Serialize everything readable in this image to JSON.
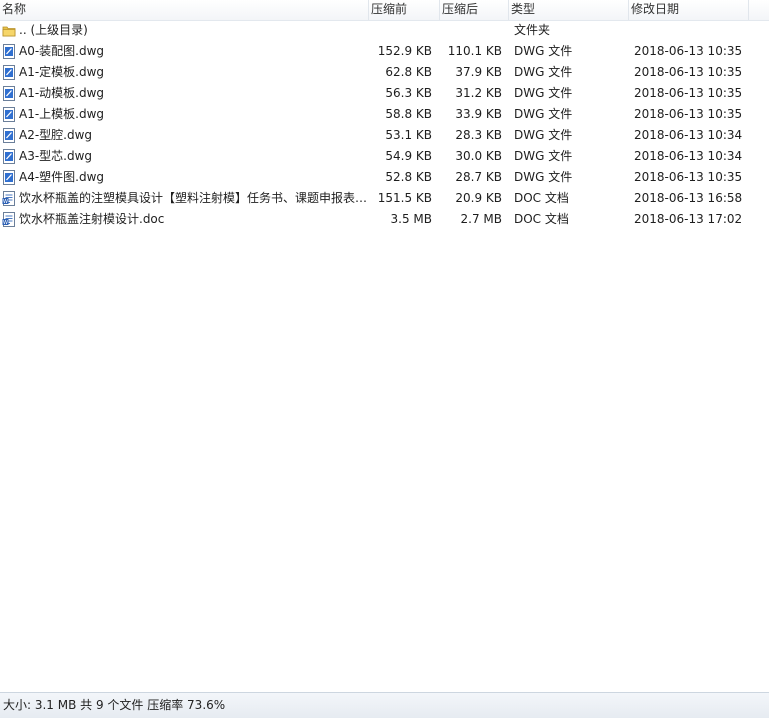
{
  "columns": {
    "name": "名称",
    "before": "压缩前",
    "after": "压缩后",
    "type": "类型",
    "modified": "修改日期"
  },
  "files": [
    {
      "name": ".. (上级目录)",
      "before": "",
      "after": "",
      "type": "文件夹",
      "modified": "",
      "icon": "folder-icon"
    },
    {
      "name": "A0-装配图.dwg",
      "before": "152.9 KB",
      "after": "110.1 KB",
      "type": "DWG 文件",
      "modified": "2018-06-13 10:35",
      "icon": "dwg-file-icon"
    },
    {
      "name": "A1-定模板.dwg",
      "before": "62.8 KB",
      "after": "37.9 KB",
      "type": "DWG 文件",
      "modified": "2018-06-13 10:35",
      "icon": "dwg-file-icon"
    },
    {
      "name": "A1-动模板.dwg",
      "before": "56.3 KB",
      "after": "31.2 KB",
      "type": "DWG 文件",
      "modified": "2018-06-13 10:35",
      "icon": "dwg-file-icon"
    },
    {
      "name": "A1-上模板.dwg",
      "before": "58.8 KB",
      "after": "33.9 KB",
      "type": "DWG 文件",
      "modified": "2018-06-13 10:35",
      "icon": "dwg-file-icon"
    },
    {
      "name": "A2-型腔.dwg",
      "before": "53.1 KB",
      "after": "28.3 KB",
      "type": "DWG 文件",
      "modified": "2018-06-13 10:34",
      "icon": "dwg-file-icon"
    },
    {
      "name": "A3-型芯.dwg",
      "before": "54.9 KB",
      "after": "30.0 KB",
      "type": "DWG 文件",
      "modified": "2018-06-13 10:34",
      "icon": "dwg-file-icon"
    },
    {
      "name": "A4-塑件图.dwg",
      "before": "52.8 KB",
      "after": "28.7 KB",
      "type": "DWG 文件",
      "modified": "2018-06-13 10:35",
      "icon": "dwg-file-icon"
    },
    {
      "name": "饮水杯瓶盖的注塑模具设计【塑料注射模】任务书、课题申报表…",
      "before": "151.5 KB",
      "after": "20.9 KB",
      "type": "DOC 文档",
      "modified": "2018-06-13 16:58",
      "icon": "doc-file-icon"
    },
    {
      "name": "饮水杯瓶盖注射模设计.doc",
      "before": "3.5 MB",
      "after": "2.7 MB",
      "type": "DOC 文档",
      "modified": "2018-06-13 17:02",
      "icon": "doc-file-icon"
    }
  ],
  "status": {
    "text": "大小: 3.1 MB 共 9 个文件 压缩率 73.6%"
  }
}
